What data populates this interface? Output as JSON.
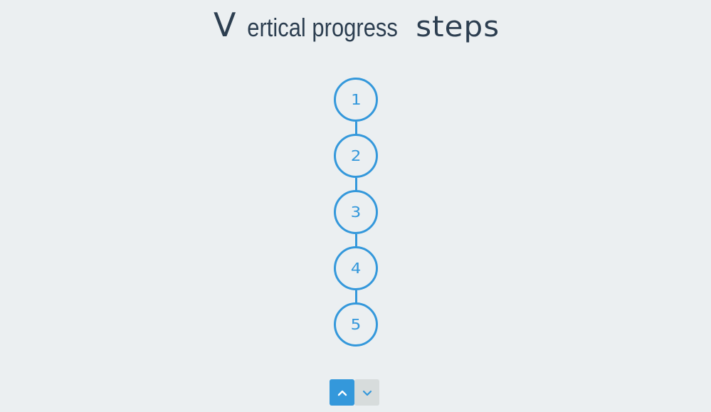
{
  "title": {
    "cap": "V",
    "light": "ertical progress",
    "strong": "steps"
  },
  "steps": [
    {
      "label": "1"
    },
    {
      "label": "2"
    },
    {
      "label": "3"
    },
    {
      "label": "4"
    },
    {
      "label": "5"
    }
  ],
  "nav": {
    "up_icon": "chevron-up-icon",
    "down_icon": "chevron-down-icon"
  },
  "colors": {
    "background": "#ebeff1",
    "accent": "#3498db",
    "title": "#2c3e50",
    "disabled_button": "#d7dcdc",
    "disabled_icon": "#3498db"
  }
}
